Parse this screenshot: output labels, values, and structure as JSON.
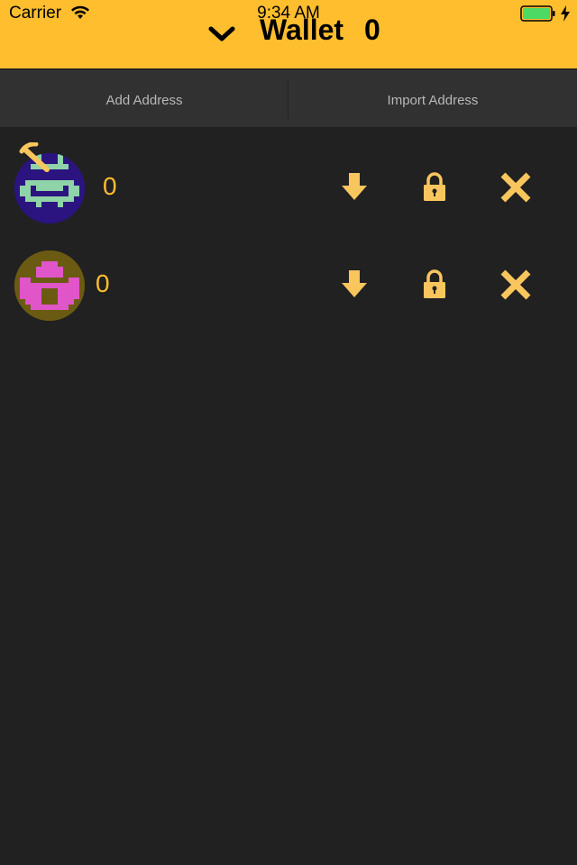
{
  "status_bar": {
    "carrier": "Carrier",
    "time": "9:34 AM",
    "wifi_icon": "wifi-icon",
    "battery_icon": "battery-icon",
    "charging_icon": "charging-bolt-icon",
    "battery_color": "#4CD964"
  },
  "header": {
    "title": "Wallet",
    "balance": "0",
    "chevron_icon": "chevron-down-icon",
    "background": "#FEBE2E"
  },
  "actions": {
    "add_label": "Add Address",
    "import_label": "Import Address"
  },
  "addresses": [
    {
      "balance": "0",
      "avatar_bg": "#2B1480",
      "avatar_fg": "#8FD3A8",
      "active_icon": "pickaxe-icon",
      "icons": [
        "download-arrow-icon",
        "lock-icon",
        "close-x-icon"
      ]
    },
    {
      "balance": "0",
      "avatar_bg": "#6B5A12",
      "avatar_fg": "#E055C8",
      "icons": [
        "download-arrow-icon",
        "lock-icon",
        "close-x-icon"
      ]
    }
  ],
  "colors": {
    "accent": "#FEBE2E",
    "background": "#212121",
    "action_bar": "#313131",
    "action_text": "#B8B8B8",
    "icon_color": "#F9C65E"
  }
}
